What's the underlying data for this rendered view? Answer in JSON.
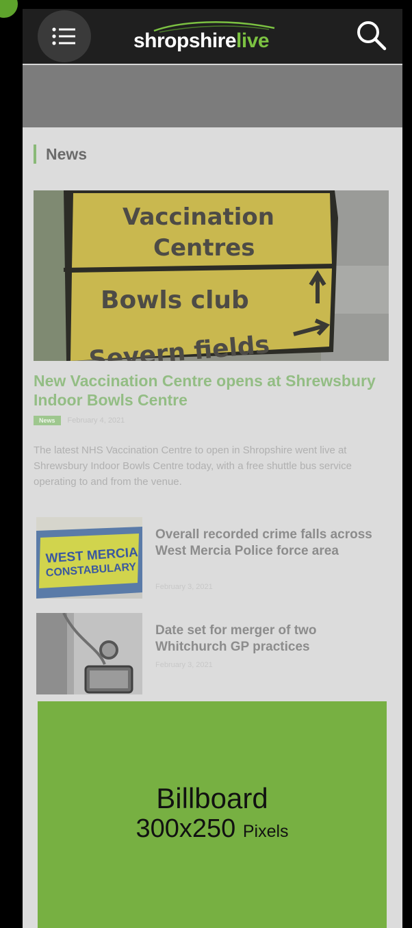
{
  "header": {
    "logo_text_white": "shropshire",
    "logo_text_green": "live",
    "menu_icon": "menu-icon",
    "search_icon": "search-icon"
  },
  "section": {
    "heading": "News"
  },
  "hero": {
    "image_sign_lines": [
      "Vaccination",
      "Centres",
      "Bowls club",
      "Severn fields"
    ],
    "title": "New Vaccination Centre opens at Shrewsbury Indoor Bowls Centre",
    "tag": "News",
    "date": "February 4, 2021",
    "excerpt": "The latest NHS Vaccination Centre to open in Shropshire went live at Shrewsbury Indoor Bowls Centre today, with a free shuttle bus service operating to and from the venue."
  },
  "articles": [
    {
      "thumb_text_1": "WEST MERCIA",
      "thumb_text_2": "CONSTABULARY",
      "title": "Overall recorded crime falls across West Mercia Police force area",
      "date": "February 3, 2021"
    },
    {
      "title": "Date set for merger of two Whitchurch GP practices",
      "date": "February 3, 2021"
    }
  ],
  "billboard": {
    "line1": "Billboard",
    "line2": "300x250",
    "line2_small": "Pixels"
  },
  "colors": {
    "header_bg": "#1f1f1f",
    "brand_green": "#7cc242",
    "billboard_green": "#77b042",
    "accent_title": "#93bd84"
  }
}
